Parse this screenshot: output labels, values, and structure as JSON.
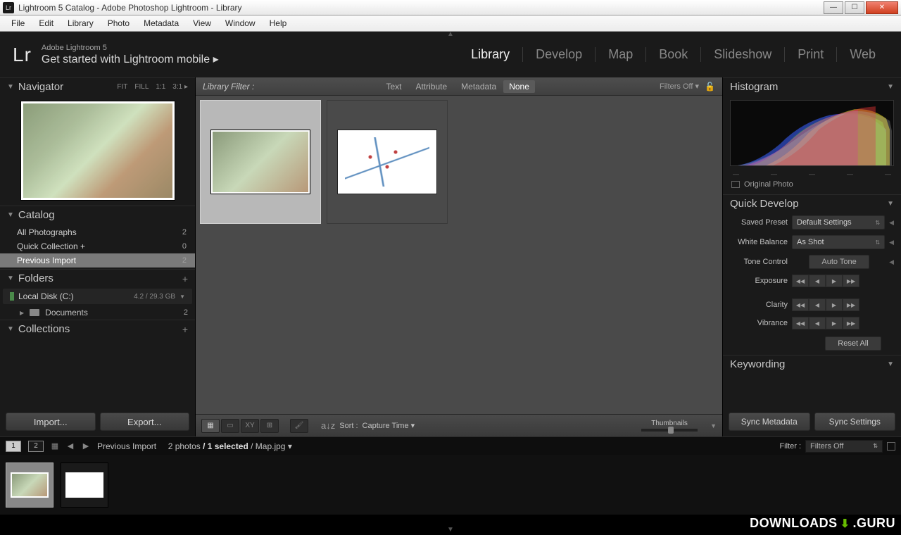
{
  "window": {
    "title": "Lightroom 5 Catalog - Adobe Photoshop Lightroom - Library"
  },
  "menu": [
    "File",
    "Edit",
    "Library",
    "Photo",
    "Metadata",
    "View",
    "Window",
    "Help"
  ],
  "identity": {
    "logo": "Lr",
    "product": "Adobe Lightroom 5",
    "tagline": "Get started with Lightroom mobile  ▸"
  },
  "modules": [
    "Library",
    "Develop",
    "Map",
    "Book",
    "Slideshow",
    "Print",
    "Web"
  ],
  "active_module": "Library",
  "left": {
    "navigator": {
      "title": "Navigator",
      "zoom": [
        "FIT",
        "FILL",
        "1:1",
        "3:1 ▸"
      ]
    },
    "catalog": {
      "title": "Catalog",
      "items": [
        {
          "label": "All Photographs",
          "count": "2"
        },
        {
          "label": "Quick Collection  +",
          "count": "0"
        },
        {
          "label": "Previous Import",
          "count": "2"
        }
      ],
      "selected": 2
    },
    "folders": {
      "title": "Folders",
      "drive": {
        "name": "Local Disk (C:)",
        "size": "4.2 / 29.3 GB"
      },
      "children": [
        {
          "name": "Documents",
          "count": "2"
        }
      ]
    },
    "collections": {
      "title": "Collections"
    },
    "buttons": {
      "import": "Import...",
      "export": "Export..."
    }
  },
  "filterbar": {
    "label": "Library Filter :",
    "opts": [
      "Text",
      "Attribute",
      "Metadata",
      "None"
    ],
    "active": "None",
    "off": "Filters Off  ▾"
  },
  "toolbar": {
    "sort_label": "Sort :",
    "sort_value": "Capture Time  ▾",
    "thumb_label": "Thumbnails"
  },
  "right": {
    "histogram": {
      "title": "Histogram",
      "original": "Original Photo"
    },
    "quickdev": {
      "title": "Quick Develop",
      "saved": {
        "label": "Saved Preset",
        "value": "Default Settings"
      },
      "wb": {
        "label": "White Balance",
        "value": "As Shot"
      },
      "tone": {
        "label": "Tone Control",
        "auto": "Auto Tone"
      },
      "sliders": [
        "Exposure",
        "Clarity",
        "Vibrance"
      ],
      "reset": "Reset All"
    },
    "keywording": {
      "title": "Keywording"
    },
    "sync": {
      "meta": "Sync Metadata",
      "settings": "Sync Settings"
    }
  },
  "filmstrip": {
    "source": "Previous Import",
    "count": "2 photos ",
    "selected": "/ 1 selected ",
    "file": "/ Map.jpg  ▾",
    "filter_label": "Filter :",
    "filter_value": "Filters Off"
  },
  "watermark": {
    "a": "DOWNLOADS",
    "b": ".GURU"
  }
}
